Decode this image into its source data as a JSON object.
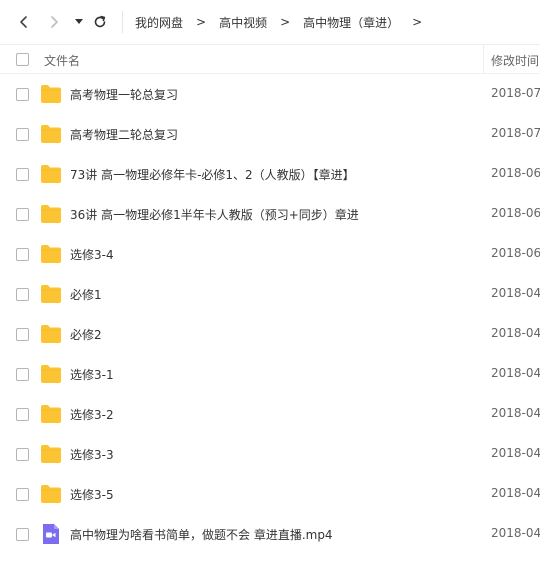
{
  "breadcrumb": [
    "我的网盘",
    "高中视频",
    "高中物理（章进）"
  ],
  "crumb_separator": ">",
  "header": {
    "name_label": "文件名",
    "date_label": "修改时间"
  },
  "folder_color": "#fcc432",
  "video_color": "#7b6cf0",
  "files": [
    {
      "name": "高考物理一轮总复习",
      "date": "2018-07-",
      "type": "folder"
    },
    {
      "name": "高考物理二轮总复习",
      "date": "2018-07-",
      "type": "folder"
    },
    {
      "name": "73讲 高一物理必修年卡-必修1、2（人教版）【章进】",
      "date": "2018-06-",
      "type": "folder"
    },
    {
      "name": "36讲 高一物理必修1半年卡人教版（预习+同步）章进",
      "date": "2018-06-",
      "type": "folder"
    },
    {
      "name": "选修3-4",
      "date": "2018-06-",
      "type": "folder"
    },
    {
      "name": "必修1",
      "date": "2018-04-",
      "type": "folder"
    },
    {
      "name": "必修2",
      "date": "2018-04-",
      "type": "folder"
    },
    {
      "name": "选修3-1",
      "date": "2018-04-",
      "type": "folder"
    },
    {
      "name": "选修3-2",
      "date": "2018-04-",
      "type": "folder"
    },
    {
      "name": "选修3-3",
      "date": "2018-04-",
      "type": "folder"
    },
    {
      "name": "选修3-5",
      "date": "2018-04-",
      "type": "folder"
    },
    {
      "name": "高中物理为啥看书简单，做题不会 章进直播.mp4",
      "date": "2018-04-",
      "type": "video"
    }
  ]
}
